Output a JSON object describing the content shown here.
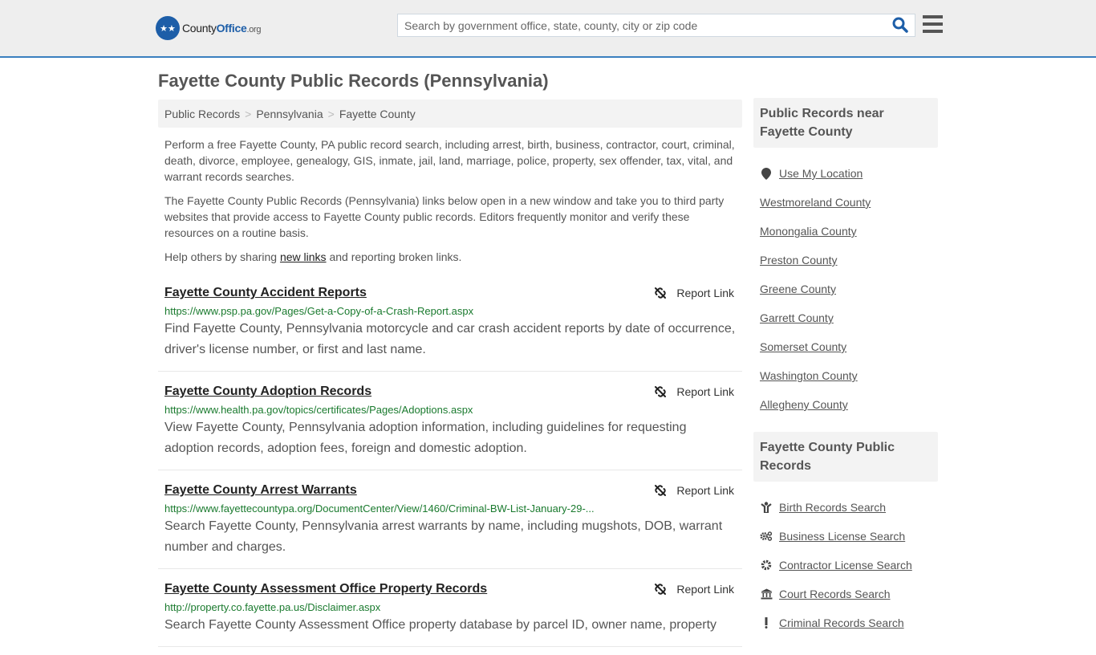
{
  "header": {
    "logo": {
      "brand_part1": "County",
      "brand_part2": "Office",
      "brand_tld": ".org"
    },
    "search": {
      "placeholder": "Search by government office, state, county, city or zip code",
      "value": ""
    }
  },
  "page_title": "Fayette County Public Records (Pennsylvania)",
  "breadcrumb": [
    {
      "label": "Public Records"
    },
    {
      "label": "Pennsylvania"
    },
    {
      "label": "Fayette County"
    }
  ],
  "breadcrumb_separator": ">",
  "intro": {
    "p1": "Perform a free Fayette County, PA public record search, including arrest, birth, business, contractor, court, criminal, death, divorce, employee, genealogy, GIS, inmate, jail, land, marriage, police, property, sex offender, tax, vital, and warrant records searches.",
    "p2": "The Fayette County Public Records (Pennsylvania) links below open in a new window and take you to third party websites that provide access to Fayette County public records. Editors frequently monitor and verify these resources on a routine basis.",
    "p3_before": "Help others by sharing ",
    "p3_link": "new links",
    "p3_after": " and reporting broken links."
  },
  "report_link_label": "Report Link",
  "records": [
    {
      "title": "Fayette County Accident Reports",
      "url": "https://www.psp.pa.gov/Pages/Get-a-Copy-of-a-Crash-Report.aspx",
      "description": "Find Fayette County, Pennsylvania motorcycle and car crash accident reports by date of occurrence, driver's license number, or first and last name."
    },
    {
      "title": "Fayette County Adoption Records",
      "url": "https://www.health.pa.gov/topics/certificates/Pages/Adoptions.aspx",
      "description": "View Fayette County, Pennsylvania adoption information, including guidelines for requesting adoption records, adoption fees, foreign and domestic adoption."
    },
    {
      "title": "Fayette County Arrest Warrants",
      "url": "https://www.fayettecountypa.org/DocumentCenter/View/1460/Criminal-BW-List-January-29-...",
      "description": "Search Fayette County, Pennsylvania arrest warrants by name, including mugshots, DOB, warrant number and charges."
    },
    {
      "title": "Fayette County Assessment Office Property Records",
      "url": "http://property.co.fayette.pa.us/Disclaimer.aspx",
      "description": "Search Fayette County Assessment Office property database by parcel ID, owner name, property"
    }
  ],
  "sidebar": {
    "near": {
      "heading": "Public Records near Fayette County",
      "items": [
        {
          "label": "Use My Location",
          "icon": "map-marker-icon"
        },
        {
          "label": "Westmoreland County"
        },
        {
          "label": "Monongalia County"
        },
        {
          "label": "Preston County"
        },
        {
          "label": "Greene County"
        },
        {
          "label": "Garrett County"
        },
        {
          "label": "Somerset County"
        },
        {
          "label": "Washington County"
        },
        {
          "label": "Allegheny County"
        }
      ]
    },
    "county_records": {
      "heading": "Fayette County Public Records",
      "items": [
        {
          "label": "Birth Records Search",
          "icon": "baby-icon"
        },
        {
          "label": "Business License Search",
          "icon": "gears-icon"
        },
        {
          "label": "Contractor License Search",
          "icon": "gear-icon"
        },
        {
          "label": "Court Records Search",
          "icon": "courthouse-icon"
        },
        {
          "label": "Criminal Records Search",
          "icon": "exclamation-icon"
        }
      ]
    }
  }
}
